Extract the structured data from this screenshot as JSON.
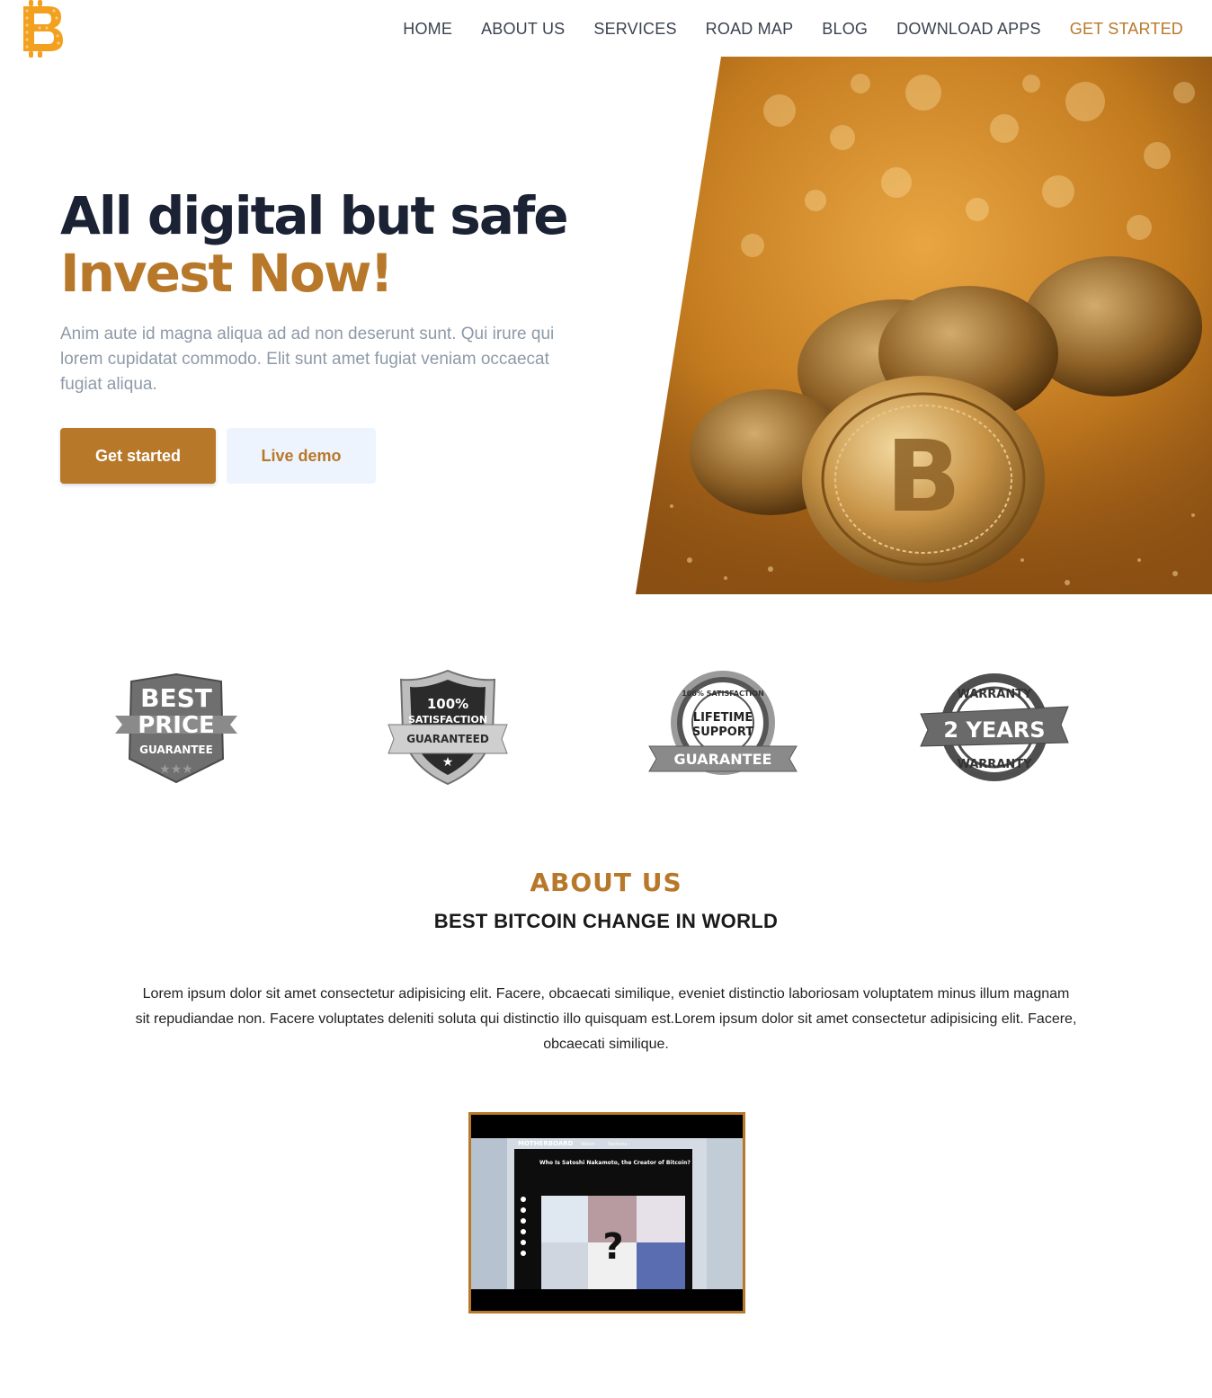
{
  "nav": {
    "logo_icon": "bitcoin-logo-icon",
    "items": [
      {
        "label": "HOME"
      },
      {
        "label": "ABOUT US"
      },
      {
        "label": "SERVICES"
      },
      {
        "label": "ROAD MAP"
      },
      {
        "label": "BLOG"
      },
      {
        "label": "DOWNLOAD APPS"
      },
      {
        "label": "GET STARTED",
        "active": true
      }
    ]
  },
  "hero": {
    "title_line1": "All digital but safe",
    "title_line2": "Invest Now!",
    "description": "Anim aute id magna aliqua ad ad non deserunt sunt. Qui irure qui lorem cupidatat commodo. Elit sunt amet fugiat veniam occaecat fugiat aliqua.",
    "primary_button": "Get started",
    "secondary_button": "Live demo",
    "image": "gold-bitcoin-coins-photo"
  },
  "badges": [
    {
      "icon": "best-price-guarantee-badge",
      "text": [
        "BEST",
        "PRICE",
        "GUARANTEE"
      ]
    },
    {
      "icon": "satisfaction-guaranteed-shield-badge",
      "text": [
        "100%",
        "SATISFACTION",
        "GUARANTEED"
      ]
    },
    {
      "icon": "lifetime-support-guarantee-badge",
      "text": [
        "100% SATISFACTION",
        "LIFETIME",
        "SUPPORT",
        "GUARANTEE"
      ]
    },
    {
      "icon": "two-years-warranty-badge",
      "text": [
        "WARRANTY",
        "2 YEARS",
        "WARRANTY"
      ]
    }
  ],
  "about": {
    "title": "ABOUT US",
    "subtitle": "BEST BITCOIN CHANGE IN WORLD",
    "body": "Lorem ipsum dolor sit amet consectetur adipisicing elit. Facere, obcaecati similique, eveniet distinctio laboriosam voluptatem minus illum magnam sit repudiandae non. Facere voluptates deleniti soluta qui distinctio illo quisquam est.Lorem ipsum dolor sit amet consectetur adipisicing elit. Facere, obcaecati similique."
  },
  "video": {
    "site_name": "MOTHERBOARD",
    "menu_1": "Watch",
    "menu_2": "Sections",
    "headline": "Who Is Satoshi Nakamoto, the Creator of Bitcoin?"
  },
  "colors": {
    "accent": "#b8782a",
    "heading": "#1a2233",
    "muted": "#8e9aa8",
    "secondary_btn_bg": "#eef4fd"
  }
}
